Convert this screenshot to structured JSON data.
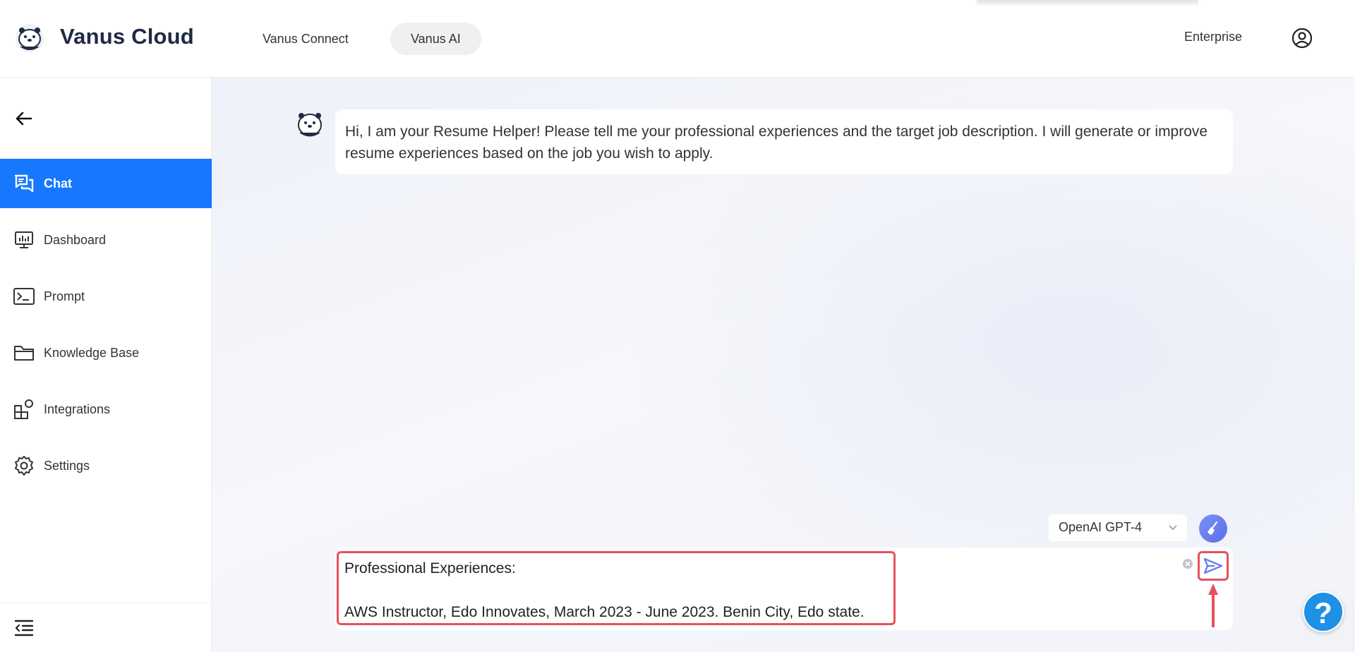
{
  "header": {
    "brand": "Vanus Cloud",
    "tabs": [
      {
        "label": "Vanus Connect",
        "active": false
      },
      {
        "label": "Vanus AI",
        "active": true
      }
    ],
    "enterprise_label": "Enterprise",
    "account_icon": "account-circle-icon"
  },
  "sidebar": {
    "back_icon": "arrow-left-icon",
    "items": [
      {
        "label": "Chat",
        "icon": "chat-icon",
        "active": true
      },
      {
        "label": "Dashboard",
        "icon": "dashboard-icon",
        "active": false
      },
      {
        "label": "Prompt",
        "icon": "terminal-icon",
        "active": false
      },
      {
        "label": "Knowledge Base",
        "icon": "folder-icon",
        "active": false
      },
      {
        "label": "Integrations",
        "icon": "integrations-icon",
        "active": false
      },
      {
        "label": "Settings",
        "icon": "gear-icon",
        "active": false
      }
    ],
    "collapse_icon": "collapse-menu-icon"
  },
  "chat": {
    "bot_message": "Hi, I am your Resume Helper! Please tell me your professional experiences and the target job description. I will generate or improve resume experiences based on the job you wish to apply.",
    "model": {
      "selected": "OpenAI GPT-4"
    },
    "input_value": "Professional Experiences:\n\nAWS Instructor, Edo Innovates, March 2023 - June 2023. Benin City, Edo state.",
    "send_icon": "send-icon",
    "clear_icon": "clear-circle-icon",
    "clear_chat_icon": "broom-icon"
  },
  "help": {
    "label": "?"
  },
  "colors": {
    "accent": "#1677ff",
    "annotation": "#e8505b",
    "brand_text": "#1f2a44",
    "help": "#1e90e6"
  }
}
